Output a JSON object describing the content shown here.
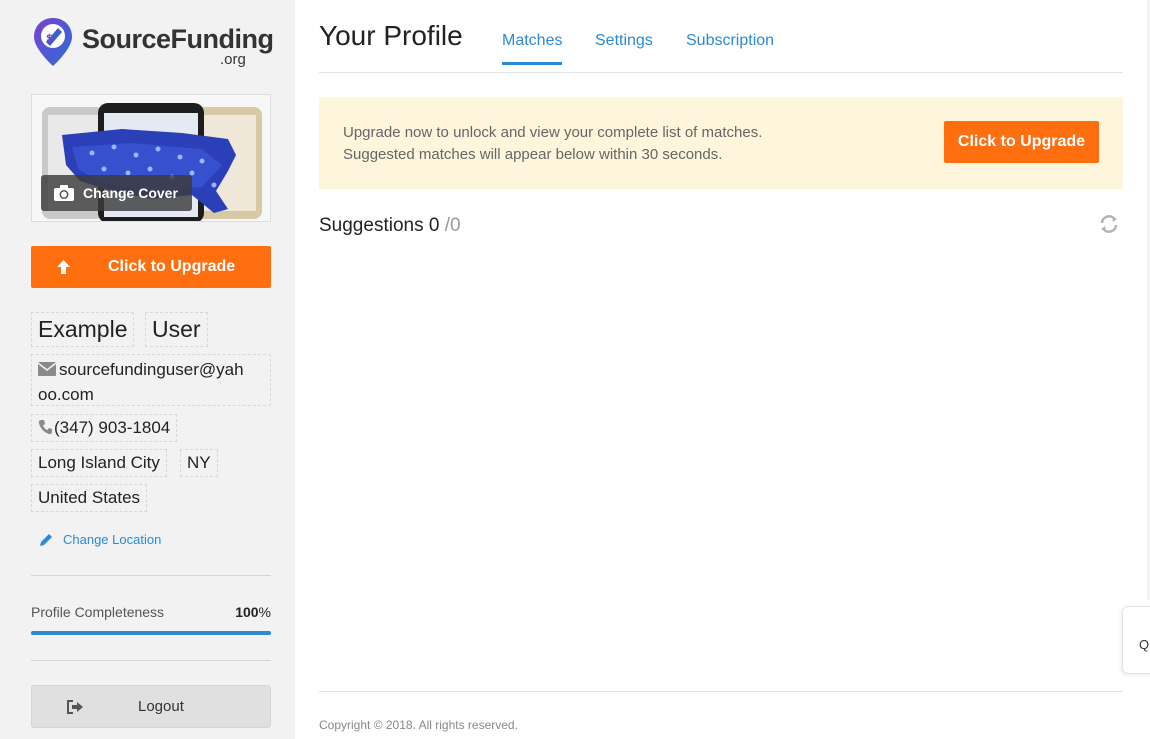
{
  "logo": {
    "name": "SourceFunding",
    "suffix": ".org"
  },
  "sidebar": {
    "change_cover_label": "Change Cover",
    "upgrade_label": "Click to Upgrade",
    "first_name": "Example",
    "last_name": "User",
    "email_line1": "sourcefundinguser@yah",
    "email_line2": "oo.com",
    "phone": "(347) 903-1804",
    "city": "Long Island City",
    "state": "NY",
    "country": "United States",
    "change_location_label": "Change Location",
    "completeness_label": "Profile Completeness",
    "completeness_value": "100",
    "completeness_unit": "%",
    "completeness_fraction": 1.0,
    "logout_label": "Logout"
  },
  "main": {
    "title": "Your Profile",
    "tabs": [
      {
        "label": "Matches",
        "active": true
      },
      {
        "label": "Settings",
        "active": false
      },
      {
        "label": "Subscription",
        "active": false
      }
    ],
    "banner": {
      "line1": "Upgrade now to unlock and view your complete list of matches.",
      "line2": "Suggested matches will appear below within 30 seconds.",
      "button_label": "Click to Upgrade"
    },
    "suggestions": {
      "label": "Suggestions",
      "count": "0",
      "total": "/0"
    },
    "footer": "Copyright © 2018. All rights reserved."
  },
  "widget": {
    "glyph": "Q"
  },
  "colors": {
    "accent": "#2a8ad4",
    "upgrade": "#ff6f0f",
    "banner_bg": "#fdf6dd",
    "sidebar_bg": "#f2f2f2"
  },
  "icons": [
    "logo-pin-icon",
    "camera-icon",
    "arrow-up-icon",
    "envelope-icon",
    "phone-icon",
    "pencil-icon",
    "logout-icon",
    "refresh-icon"
  ]
}
